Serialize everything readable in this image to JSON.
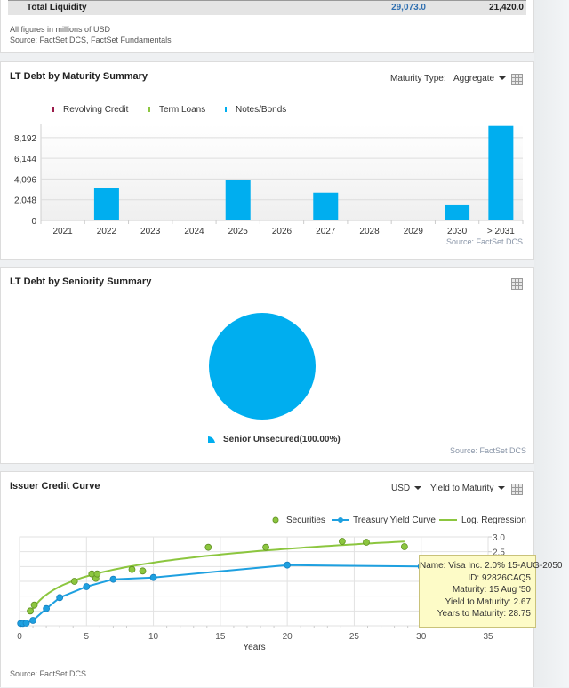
{
  "liquidity_panel": {
    "row_label": "Total Liquidity",
    "value_1": "29,073.0",
    "value_2": "21,420.0",
    "note": "All figures in millions of USD",
    "source": "Source: FactSet DCS, FactSet Fundamentals"
  },
  "maturity_panel": {
    "title": "LT Debt by Maturity Summary",
    "maturity_type_label": "Maturity Type:",
    "maturity_type_value": "Aggregate",
    "table_icon": "grid-table-icon",
    "source": "Source: FactSet DCS"
  },
  "seniority_panel": {
    "title": "LT Debt by Seniority Summary",
    "table_icon": "grid-table-icon",
    "source": "Source: FactSet DCS"
  },
  "credit_panel": {
    "title": "Issuer Credit Curve",
    "currency_value": "USD",
    "measure_value": "Yield to Maturity",
    "table_icon": "grid-table-icon",
    "source": "Source: FactSet DCS",
    "tooltip": {
      "name": "Name: Visa Inc. 2.0% 15-AUG-2050",
      "id": "ID: 92826CAQ5",
      "maturity": "Maturity: 15 Aug '50",
      "ytm": "Yield to Maturity: 2.67",
      "years": "Years to Maturity: 28.75"
    }
  },
  "chart_data": [
    {
      "type": "bar",
      "title": "LT Debt by Maturity Summary",
      "categories": [
        "2021",
        "2022",
        "2023",
        "2024",
        "2025",
        "2026",
        "2027",
        "2028",
        "2029",
        "2030",
        "> 2031"
      ],
      "series": [
        {
          "name": "Revolving Credit",
          "color": "#9b1b4a",
          "values": [
            0,
            0,
            0,
            0,
            0,
            0,
            0,
            0,
            0,
            0,
            0
          ]
        },
        {
          "name": "Term Loans",
          "color": "#8cc63f",
          "values": [
            0,
            0,
            0,
            0,
            0,
            0,
            0,
            0,
            0,
            0,
            0
          ]
        },
        {
          "name": "Notes/Bonds",
          "color": "#00aeef",
          "values": [
            0,
            3250,
            0,
            0,
            4000,
            0,
            2750,
            0,
            0,
            1500,
            9350
          ]
        }
      ],
      "yticks": [
        "0",
        "2,048",
        "4,096",
        "6,144",
        "8,192"
      ],
      "ytick_values": [
        0,
        2048,
        4096,
        6144,
        8192
      ],
      "ylim": [
        0,
        9500
      ],
      "legend": "top-left",
      "grid": true
    },
    {
      "type": "pie",
      "title": "LT Debt by Seniority Summary",
      "slices": [
        {
          "label": "Senior Unsecured(100.00%)",
          "value": 100.0,
          "color": "#00aeef"
        }
      ],
      "legend": "bottom"
    },
    {
      "type": "scatter",
      "title": "Issuer Credit Curve",
      "xlabel": "Years",
      "ylabel": "",
      "xlim": [
        0,
        35
      ],
      "ylim": [
        0,
        3.0
      ],
      "xticks": [
        "0",
        "5",
        "10",
        "15",
        "20",
        "25",
        "30",
        "35"
      ],
      "xtick_values": [
        0,
        5,
        10,
        15,
        20,
        25,
        30,
        35
      ],
      "yticks": [
        "3.0",
        "2.5"
      ],
      "ytick_values": [
        3.0,
        2.5
      ],
      "grid": true,
      "legend": "top-right",
      "series": [
        {
          "name": "Securities",
          "kind": "scatter",
          "color": "#8cc63f",
          "points": [
            [
              0.8,
              0.5
            ],
            [
              1.1,
              0.7
            ],
            [
              4.1,
              1.5
            ],
            [
              5.4,
              1.75
            ],
            [
              5.7,
              1.6
            ],
            [
              5.8,
              1.75
            ],
            [
              8.4,
              1.9
            ],
            [
              9.2,
              1.85
            ],
            [
              14.1,
              2.65
            ],
            [
              18.4,
              2.65
            ],
            [
              24.1,
              2.85
            ],
            [
              25.9,
              2.82
            ],
            [
              28.75,
              2.67
            ]
          ]
        },
        {
          "name": "Treasury Yield Curve",
          "kind": "line-marker",
          "color": "#1ea0e0",
          "points": [
            [
              0.08,
              0.08
            ],
            [
              0.25,
              0.08
            ],
            [
              0.5,
              0.09
            ],
            [
              1,
              0.18
            ],
            [
              2,
              0.58
            ],
            [
              3,
              0.95
            ],
            [
              5,
              1.32
            ],
            [
              7,
              1.57
            ],
            [
              10,
              1.63
            ],
            [
              20,
              2.05
            ],
            [
              30,
              2.0
            ]
          ]
        },
        {
          "name": "Log. Regression",
          "kind": "line",
          "color": "#8cc63f",
          "x_range": [
            0.8,
            28.75
          ]
        }
      ]
    }
  ]
}
